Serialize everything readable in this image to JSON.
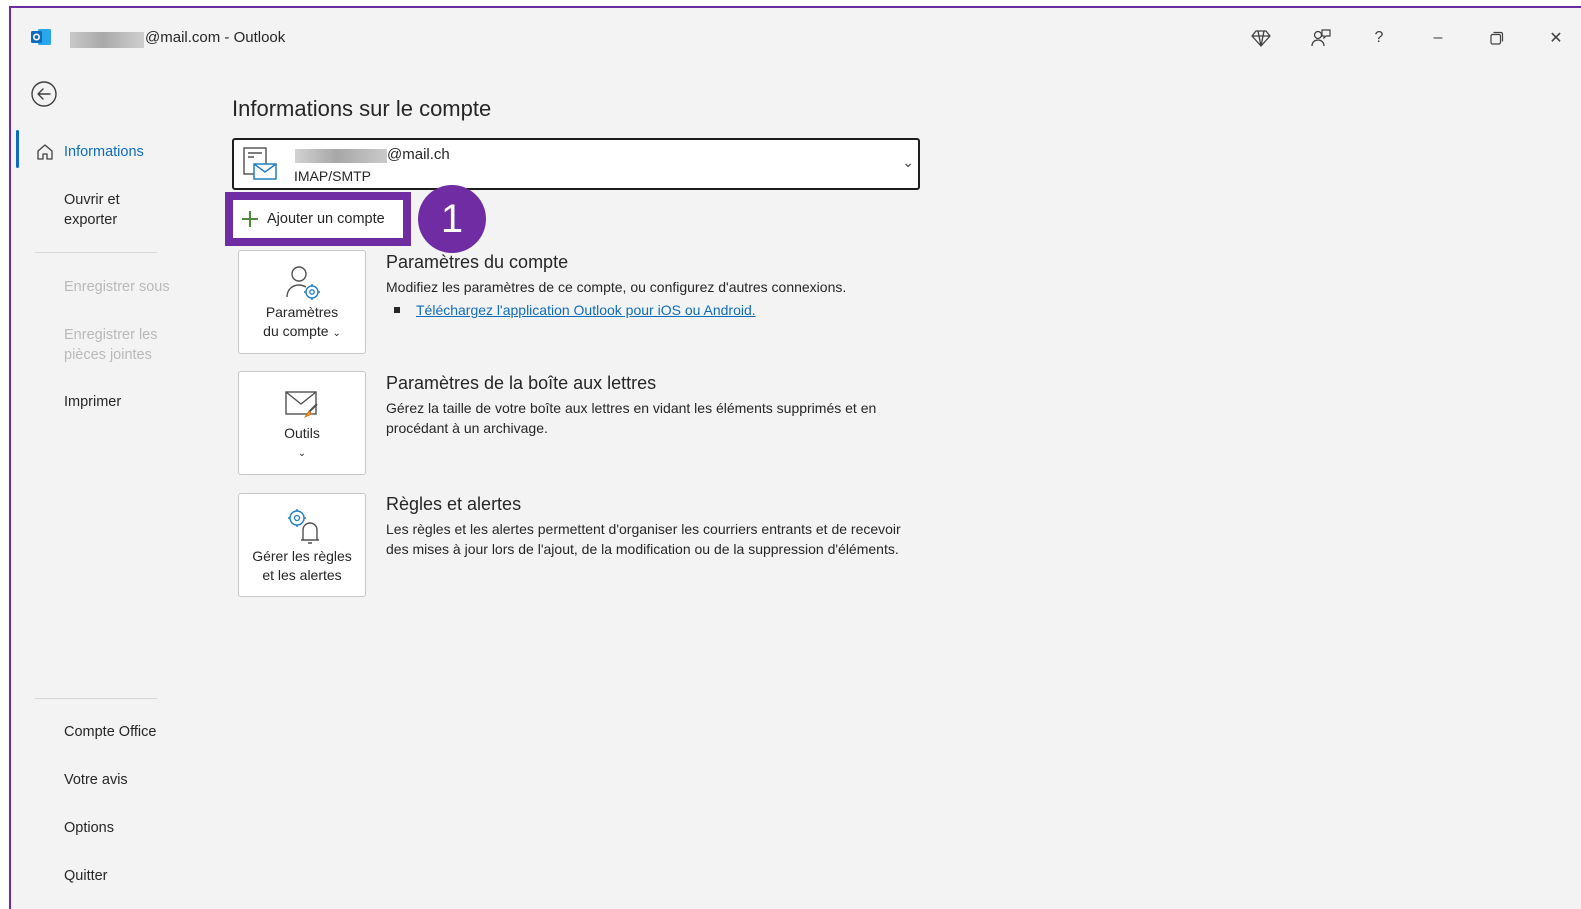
{
  "window": {
    "title_suffix": "@mail.com  -  Outlook",
    "buttons": {
      "premium": "◆",
      "feedback": "⚐",
      "help": "?",
      "minimize": "–",
      "restore": "❐",
      "close": "✕"
    }
  },
  "sidebar": {
    "items": [
      {
        "label": "Informations",
        "state": "active"
      },
      {
        "label": "Ouvrir et exporter",
        "state": "normal"
      },
      {
        "label": "Enregistrer sous",
        "state": "disabled"
      },
      {
        "label": "Enregistrer les pièces jointes",
        "state": "disabled"
      },
      {
        "label": "Imprimer",
        "state": "normal"
      }
    ],
    "bottom_items": [
      {
        "label": "Compte Office"
      },
      {
        "label": "Votre avis"
      },
      {
        "label": "Options"
      },
      {
        "label": "Quitter"
      }
    ]
  },
  "main": {
    "title": "Informations sur le compte",
    "account": {
      "email_suffix": "@mail.ch",
      "type": "IMAP/SMTP"
    },
    "add_account_label": "Ajouter un compte",
    "step_number": "1",
    "sections": [
      {
        "tile_label_line1": "Paramètres",
        "tile_label_line2": "du compte",
        "title": "Paramètres du compte",
        "description": "Modifiez les paramètres de ce compte, ou configurez d'autres connexions.",
        "link": "Téléchargez l'application Outlook pour iOS ou Android."
      },
      {
        "tile_label_line1": "Outils",
        "title": "Paramètres de la boîte aux lettres",
        "description": "Gérez la taille de votre boîte aux lettres en vidant les éléments supprimés et en procédant à un archivage."
      },
      {
        "tile_label_line1": "Gérer les règles",
        "tile_label_line2": "et les alertes",
        "title": "Règles et alertes",
        "description": "Les règles et les alertes permettent d'organiser les courriers entrants et de recevoir des mises à jour lors de l'ajout, de la modification ou de la suppression d'éléments."
      }
    ]
  },
  "colors": {
    "accent": "#0f6cbd",
    "highlight": "#6f2ca3",
    "background": "#f3f3f3"
  }
}
